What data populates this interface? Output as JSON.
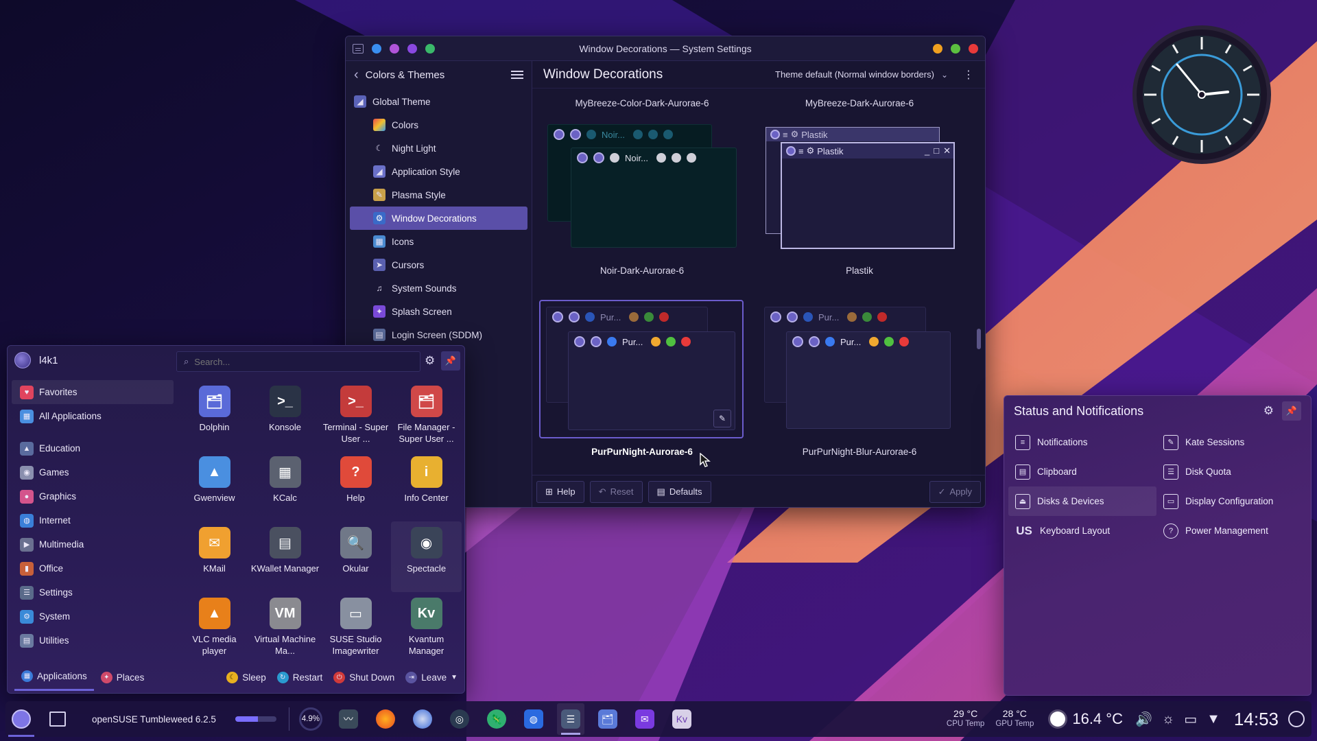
{
  "settings_window": {
    "title": "Window Decorations — System Settings",
    "sidebar": {
      "header": "Colors & Themes",
      "items": [
        {
          "label": "Global Theme"
        },
        {
          "label": "Colors"
        },
        {
          "label": "Night Light"
        },
        {
          "label": "Application Style"
        },
        {
          "label": "Plasma Style"
        },
        {
          "label": "Window Decorations"
        },
        {
          "label": "Icons"
        },
        {
          "label": "Cursors"
        },
        {
          "label": "System Sounds"
        },
        {
          "label": "Splash Screen"
        },
        {
          "label": "Login Screen (SDDM)"
        }
      ]
    },
    "main": {
      "title": "Window Decorations",
      "theme_select": "Theme default (Normal window borders)",
      "decorations": [
        {
          "label": "MyBreeze-Color-Dark-Aurorae-6"
        },
        {
          "label": "MyBreeze-Dark-Aurorae-6"
        },
        {
          "label": "Noir-Dark-Aurorae-6",
          "preview_title": "Noir..."
        },
        {
          "label": "Plastik",
          "preview_title": "Plastik"
        },
        {
          "label": "PurPurNight-Aurorae-6",
          "preview_title": "Pur..."
        },
        {
          "label": "PurPurNight-Blur-Aurorae-6",
          "preview_title": "Pur..."
        }
      ],
      "selected": "PurPurNight-Aurorae-6"
    },
    "footer": {
      "help": "Help",
      "reset": "Reset",
      "defaults": "Defaults",
      "apply": "Apply"
    }
  },
  "launcher": {
    "username": "l4k1",
    "search_placeholder": "Search...",
    "categories": [
      {
        "label": "Favorites",
        "color": "#e0445e"
      },
      {
        "label": "All Applications",
        "color": "#4a8fe0"
      },
      {
        "label": "Education",
        "color": "#5a6b9e"
      },
      {
        "label": "Games",
        "color": "#8a8fae"
      },
      {
        "label": "Graphics",
        "color": "#d4548c"
      },
      {
        "label": "Internet",
        "color": "#3a7fd8"
      },
      {
        "label": "Multimedia",
        "color": "#6a7090"
      },
      {
        "label": "Office",
        "color": "#c8603a"
      },
      {
        "label": "Settings",
        "color": "#5a6a8a"
      },
      {
        "label": "System",
        "color": "#3a8ad8"
      },
      {
        "label": "Utilities",
        "color": "#6a7aa0"
      }
    ],
    "apps": [
      {
        "label": "Dolphin",
        "icon": "folder-icon",
        "glyph": "🗂",
        "color": "#5a6ad8"
      },
      {
        "label": "Konsole",
        "icon": "terminal-icon",
        "glyph": ">_",
        "color": "#2a3346"
      },
      {
        "label": "Terminal - Super User ...",
        "icon": "root-terminal-icon",
        "glyph": ">_",
        "color": "#c43b3b"
      },
      {
        "label": "File Manager - Super User ...",
        "icon": "root-folder-icon",
        "glyph": "🗂",
        "color": "#d04848"
      },
      {
        "label": "Gwenview",
        "icon": "image-viewer-icon",
        "glyph": "▲",
        "color": "#4a8fe0"
      },
      {
        "label": "KCalc",
        "icon": "calculator-icon",
        "glyph": "▦",
        "color": "#5b6170"
      },
      {
        "label": "Help",
        "icon": "help-icon",
        "glyph": "?",
        "color": "#e04a3a"
      },
      {
        "label": "Info Center",
        "icon": "info-icon",
        "glyph": "i",
        "color": "#e8b030"
      },
      {
        "label": "KMail",
        "icon": "mail-icon",
        "glyph": "✉",
        "color": "#f0a030"
      },
      {
        "label": "KWallet Manager",
        "icon": "wallet-icon",
        "glyph": "▤",
        "color": "#4a5060"
      },
      {
        "label": "Okular",
        "icon": "document-viewer-icon",
        "glyph": "🔍",
        "color": "#707888"
      },
      {
        "label": "Spectacle",
        "icon": "screenshot-icon",
        "glyph": "◉",
        "color": "#3a4458"
      },
      {
        "label": "VLC media player",
        "icon": "vlc-icon",
        "glyph": "▲",
        "color": "#e8801a"
      },
      {
        "label": "Virtual Machine Ma...",
        "icon": "virtual-machine-icon",
        "glyph": "VM",
        "color": "#8a8a90"
      },
      {
        "label": "SUSE Studio Imagewriter",
        "icon": "imagewriter-icon",
        "glyph": "▭",
        "color": "#8890a0"
      },
      {
        "label": "Kvantum Manager",
        "icon": "kvantum-icon",
        "glyph": "Kv",
        "color": "#4a7a6a"
      }
    ],
    "footer": {
      "applications": "Applications",
      "places": "Places",
      "sleep": "Sleep",
      "restart": "Restart",
      "shutdown": "Shut Down",
      "leave": "Leave"
    }
  },
  "tray_popup": {
    "title": "Status and Notifications",
    "items": [
      {
        "label": "Notifications",
        "icon": "notifications-icon",
        "glyph": "≡"
      },
      {
        "label": "Kate Sessions",
        "icon": "kate-icon",
        "glyph": "✎"
      },
      {
        "label": "Clipboard",
        "icon": "clipboard-icon",
        "glyph": "▤"
      },
      {
        "label": "Disk Quota",
        "icon": "disk-quota-icon",
        "glyph": "☰"
      },
      {
        "label": "Disks & Devices",
        "icon": "disks-icon",
        "glyph": "⏏"
      },
      {
        "label": "Display Configuration",
        "icon": "display-icon",
        "glyph": "▭"
      },
      {
        "label": "Keyboard Layout",
        "icon": "keyboard-layout-icon",
        "glyph": "US"
      },
      {
        "label": "Power Management",
        "icon": "power-icon",
        "glyph": "?"
      }
    ]
  },
  "taskbar": {
    "distro": "openSUSE Tumbleweed 6.2.5",
    "cpu_usage": "4.9%",
    "cpu_temp": {
      "value": "29 °C",
      "label": "CPU Temp"
    },
    "gpu_temp": {
      "value": "28 °C",
      "label": "GPU Temp"
    },
    "weather": "16.4 °C",
    "time": "14:53"
  },
  "colors": {
    "accent": "#5a4fa8",
    "selection_border": "#6b5ccc"
  }
}
